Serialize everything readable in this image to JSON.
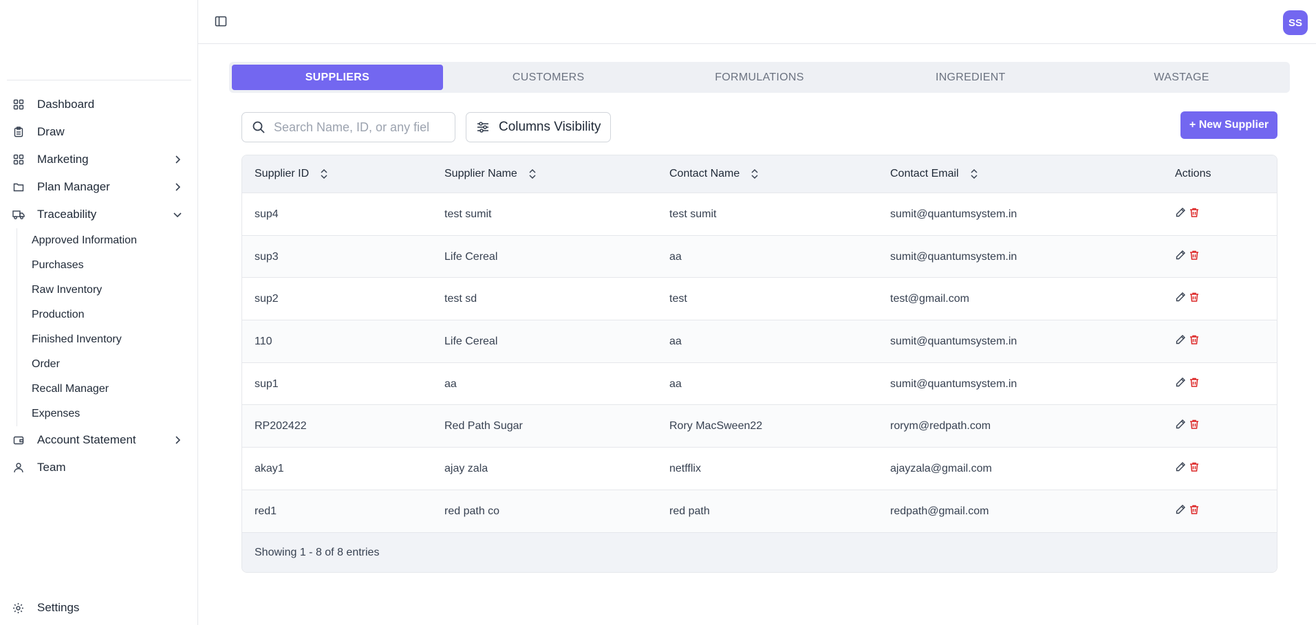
{
  "sidebar": {
    "items": [
      {
        "label": "Dashboard",
        "icon": "grid-icon"
      },
      {
        "label": "Draw",
        "icon": "clipboard-icon"
      },
      {
        "label": "Marketing",
        "icon": "grid-icon",
        "chevron": "right"
      },
      {
        "label": "Plan Manager",
        "icon": "folder-icon",
        "chevron": "right"
      },
      {
        "label": "Traceability",
        "icon": "truck-icon",
        "chevron": "down"
      }
    ],
    "traceability_sub": [
      "Approved Information",
      "Purchases",
      "Raw Inventory",
      "Production",
      "Finished Inventory",
      "Order",
      "Recall Manager",
      "Expenses"
    ],
    "items_after": [
      {
        "label": "Account Statement",
        "icon": "wallet-icon",
        "chevron": "right"
      },
      {
        "label": "Team",
        "icon": "user-icon"
      }
    ],
    "settings_label": "Settings"
  },
  "header": {
    "avatar_initials": "SS"
  },
  "tabs": [
    {
      "label": "SUPPLIERS",
      "active": true
    },
    {
      "label": "CUSTOMERS",
      "active": false
    },
    {
      "label": "FORMULATIONS",
      "active": false
    },
    {
      "label": "INGREDIENT",
      "active": false
    },
    {
      "label": "WASTAGE",
      "active": false
    }
  ],
  "toolbar": {
    "search_placeholder": "Search Name, ID, or any fiel",
    "columns_label": "Columns Visibility",
    "new_label": "+ New Supplier"
  },
  "table": {
    "headers": [
      "Supplier ID",
      "Supplier Name",
      "Contact Name",
      "Contact Email",
      "Actions"
    ],
    "rows": [
      [
        "sup4",
        "test sumit",
        "test sumit",
        "sumit@quantumsystem.in"
      ],
      [
        "sup3",
        "Life Cereal",
        "aa",
        "sumit@quantumsystem.in"
      ],
      [
        "sup2",
        "test sd",
        "test",
        "test@gmail.com"
      ],
      [
        "110",
        "Life Cereal",
        "aa",
        "sumit@quantumsystem.in"
      ],
      [
        "sup1",
        "aa",
        "aa",
        "sumit@quantumsystem.in"
      ],
      [
        "RP202422",
        "Red Path Sugar",
        "Rory MacSween22",
        "rorym@redpath.com"
      ],
      [
        "akay1",
        "ajay zala",
        "netfflix",
        "ajayzala@gmail.com"
      ],
      [
        "red1",
        "red path co",
        "red path",
        "redpath@gmail.com"
      ]
    ],
    "footer": "Showing 1 - 8 of 8 entries"
  },
  "colors": {
    "accent": "#7367f0",
    "danger": "#dc2626"
  }
}
